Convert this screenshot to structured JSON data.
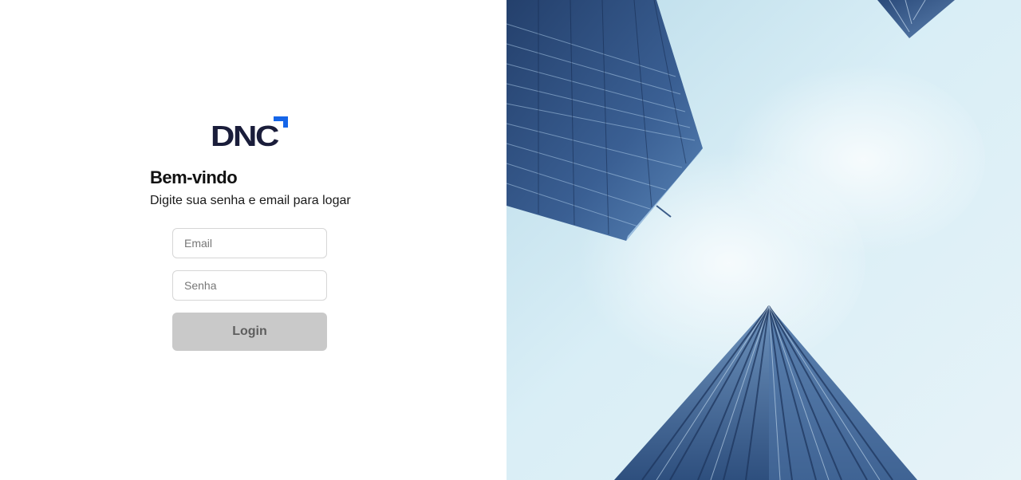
{
  "logo": {
    "text": "DNC",
    "accent_color": "#1565e8",
    "text_color": "#1a1d3a"
  },
  "login": {
    "title": "Bem-vindo",
    "subtitle": "Digite sua senha e email para logar",
    "email_placeholder": "Email",
    "email_value": "",
    "password_placeholder": "Senha",
    "password_value": "",
    "button_label": "Login",
    "button_color": "#c9c9c9"
  },
  "hero_image": {
    "subject": "skyscrapers-from-below"
  }
}
